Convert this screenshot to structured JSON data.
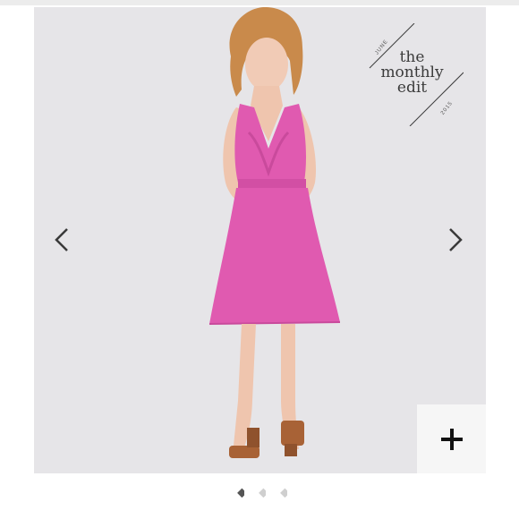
{
  "badge": {
    "line1": "the",
    "line2": "monthly",
    "line3": "edit",
    "month": "JUNE",
    "year": "2015"
  },
  "carousel": {
    "prev_icon": "chevron-left-icon",
    "next_icon": "chevron-right-icon",
    "zoom_icon": "plus-icon",
    "slide_count": 3,
    "active_slide": 1
  },
  "colors": {
    "dress": "#e05ab0",
    "background": "#e6e5e8",
    "dot_active": "#555555",
    "dot_inactive": "#cfcfcf"
  }
}
